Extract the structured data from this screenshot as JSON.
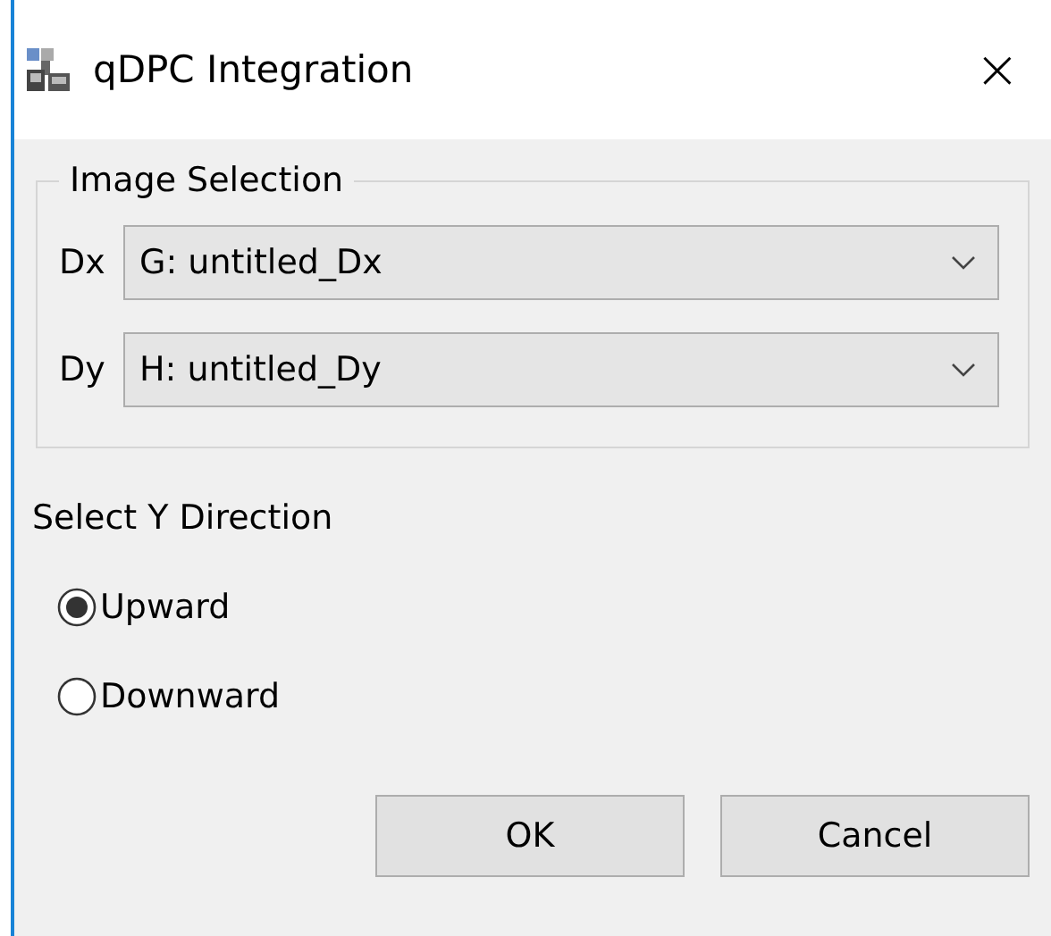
{
  "window": {
    "title": "qDPC Integration",
    "close": "×"
  },
  "image_selection": {
    "title": "Image Selection",
    "fields": [
      {
        "label": "Dx",
        "value": "G: untitled_Dx"
      },
      {
        "label": "Dy",
        "value": "H: untitled_Dy"
      }
    ]
  },
  "direction": {
    "title": "Select Y Direction",
    "options": [
      {
        "label": "Upward",
        "selected": true
      },
      {
        "label": "Downward",
        "selected": false
      }
    ]
  },
  "buttons": [
    "OK",
    "Cancel"
  ]
}
